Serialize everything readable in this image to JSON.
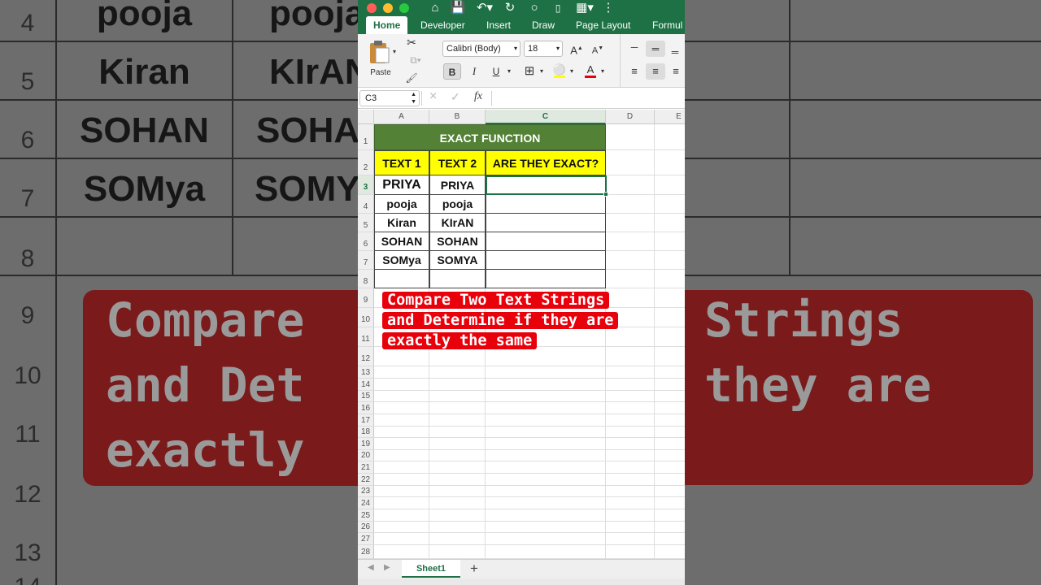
{
  "background": {
    "row_numbers": [
      "4",
      "5",
      "6",
      "7",
      "8",
      "9",
      "10",
      "11",
      "12",
      "13",
      "14"
    ],
    "col_a": [
      "pooja",
      "Kiran",
      "SOHAN",
      "SOMya"
    ],
    "col_b": [
      "pooja",
      "KIrAN",
      "SOHAN",
      "SOMY"
    ],
    "banner_lines": [
      "Compare",
      "Strings",
      "and Det",
      "they are",
      "exactly"
    ]
  },
  "window": {
    "traffic_colors": [
      "#ff5f57",
      "#febc2e",
      "#28c840"
    ],
    "quick_access_icons": [
      "home-icon",
      "save-icon",
      "undo-icon",
      "redo-icon",
      "circle-icon",
      "doc-icon",
      "grid-icon"
    ],
    "tabs": [
      "Home",
      "Developer",
      "Insert",
      "Draw",
      "Page Layout",
      "Formul"
    ],
    "active_tab": "Home",
    "ribbon": {
      "paste_label": "Paste",
      "font_name": "Calibri (Body)",
      "font_size": "18",
      "grow_font": "A",
      "shrink_font": "A",
      "bold": "B",
      "italic": "I",
      "underline": "U",
      "font_color_letter": "A"
    },
    "formula_bar": {
      "name_box": "C3",
      "fx": "fx",
      "cancel": "×",
      "confirm": "✓",
      "value": ""
    }
  },
  "sheet": {
    "columns": [
      "A",
      "B",
      "C",
      "D",
      "E"
    ],
    "rows": [
      "1",
      "2",
      "3",
      "4",
      "5",
      "6",
      "7",
      "8",
      "9",
      "10",
      "11",
      "12",
      "13",
      "14",
      "15",
      "16",
      "17",
      "18",
      "19",
      "20",
      "21",
      "22",
      "23",
      "24",
      "25",
      "26",
      "27",
      "28"
    ],
    "title": "EXACT FUNCTION",
    "headers": [
      "TEXT 1",
      "TEXT 2",
      "ARE THEY EXACT?"
    ],
    "text1": [
      "PRIYA",
      "pooja",
      "Kiran",
      "SOHAN",
      "SOMya"
    ],
    "text2": [
      "PRIYA",
      "pooja",
      "KIrAN",
      "SOHAN",
      "SOMYA"
    ],
    "selected_cell": "C3",
    "colors": {
      "title_bg": "#538135",
      "header_bg": "#ffff00",
      "accent": "#1e7145",
      "banner": "#e8000b"
    }
  },
  "banner": {
    "lines": [
      "Compare Two Text Strings",
      "and Determine if they are",
      "exactly the same"
    ]
  },
  "sheet_tabs": {
    "active": "Sheet1",
    "add": "+"
  }
}
